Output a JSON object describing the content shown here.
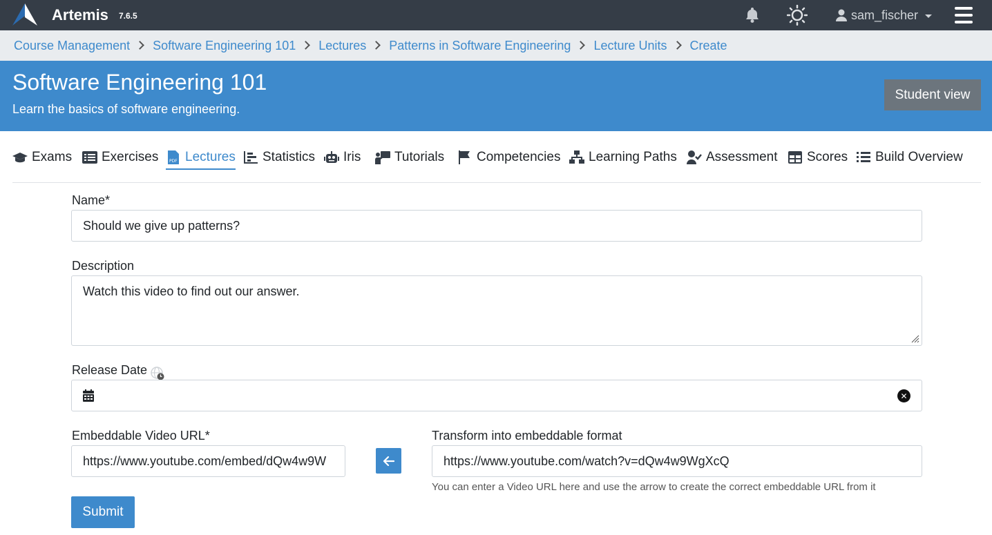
{
  "navbar": {
    "brand": "Artemis",
    "version": "7.6.5",
    "username": "sam_fischer",
    "icons": [
      "artemis-logo",
      "bell-icon",
      "sun-icon",
      "user-icon",
      "hamburger-icon"
    ]
  },
  "breadcrumb": [
    {
      "label": "Course Management"
    },
    {
      "label": "Software Engineering 101"
    },
    {
      "label": "Lectures"
    },
    {
      "label": "Patterns in Software Engineering"
    },
    {
      "label": "Lecture Units"
    },
    {
      "label": "Create"
    }
  ],
  "course": {
    "title": "Software Engineering 101",
    "description": "Learn the basics of software engineering.",
    "student_view_label": "Student view"
  },
  "tabs": [
    {
      "label": "Exams",
      "icon": "graduation-cap-icon"
    },
    {
      "label": "Exercises",
      "icon": "list-alt-icon"
    },
    {
      "label": "Lectures",
      "icon": "file-pdf-icon",
      "active": true
    },
    {
      "label": "Statistics",
      "icon": "chart-bar-icon"
    },
    {
      "label": "Iris",
      "icon": "robot-icon"
    },
    {
      "label": "Tutorials",
      "icon": "chalkboard-teacher-icon"
    },
    {
      "label": "Competencies",
      "icon": "flag-icon"
    },
    {
      "label": "Learning Paths",
      "icon": "network-icon"
    },
    {
      "label": "Assessment",
      "icon": "user-check-icon"
    },
    {
      "label": "Scores",
      "icon": "table-icon"
    },
    {
      "label": "Build Overview",
      "icon": "list-icon"
    }
  ],
  "form": {
    "name_label": "Name*",
    "name_value": "Should we give up patterns?",
    "description_label": "Description",
    "description_value": "Watch this video to find out our answer.",
    "release_label": "Release Date",
    "release_value": "",
    "video_url_label": "Embeddable Video URL*",
    "video_url_value": "https://www.youtube.com/embed/dQw4w9W",
    "transform_label": "Transform into embeddable format",
    "transform_value": "https://www.youtube.com/watch?v=dQw4w9WgXcQ",
    "help_text": "You can enter a Video URL here and use the arrow to create the correct embeddable URL from it",
    "submit_label": "Submit"
  },
  "colors": {
    "navbar": "#353d47",
    "primary": "#3e8acc",
    "breadcrumb_bg": "#e9ecef",
    "secondary_button": "#6c757d"
  }
}
